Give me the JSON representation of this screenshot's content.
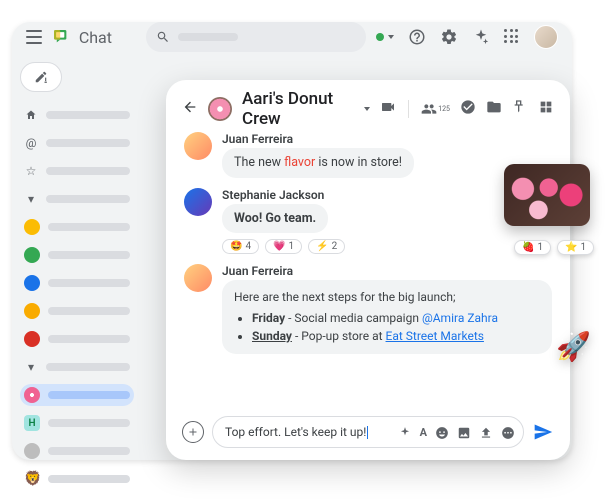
{
  "brand": "Chat",
  "space": {
    "title": "Aari's Donut Crew"
  },
  "header_tools": {
    "members_count": "125"
  },
  "sidebar": {
    "h_label": "H"
  },
  "messages": {
    "m0": {
      "author": "Juan Ferreira",
      "pre": "The new ",
      "flavor": "flavor",
      "post": " is now in store!"
    },
    "m1": {
      "author": "Stephanie Jackson",
      "text": "Woo! Go team.",
      "reacts": {
        "r0": "4",
        "r1": "1",
        "r2": "2"
      }
    },
    "m2": {
      "author": "Juan Ferreira",
      "intro": "Here are the next steps for the big launch;",
      "b0_day": "Friday",
      "b0_text": " - Social media campaign ",
      "b0_mention": "@Amira Zahra",
      "b1_day": "Sunday",
      "b1_text": " - Pop-up store at ",
      "b1_link": "Eat Street Markets"
    }
  },
  "composer": {
    "text": "Top effort. Let's keep it up!"
  },
  "ext_reacts": {
    "r0": "1",
    "r1": "1"
  }
}
